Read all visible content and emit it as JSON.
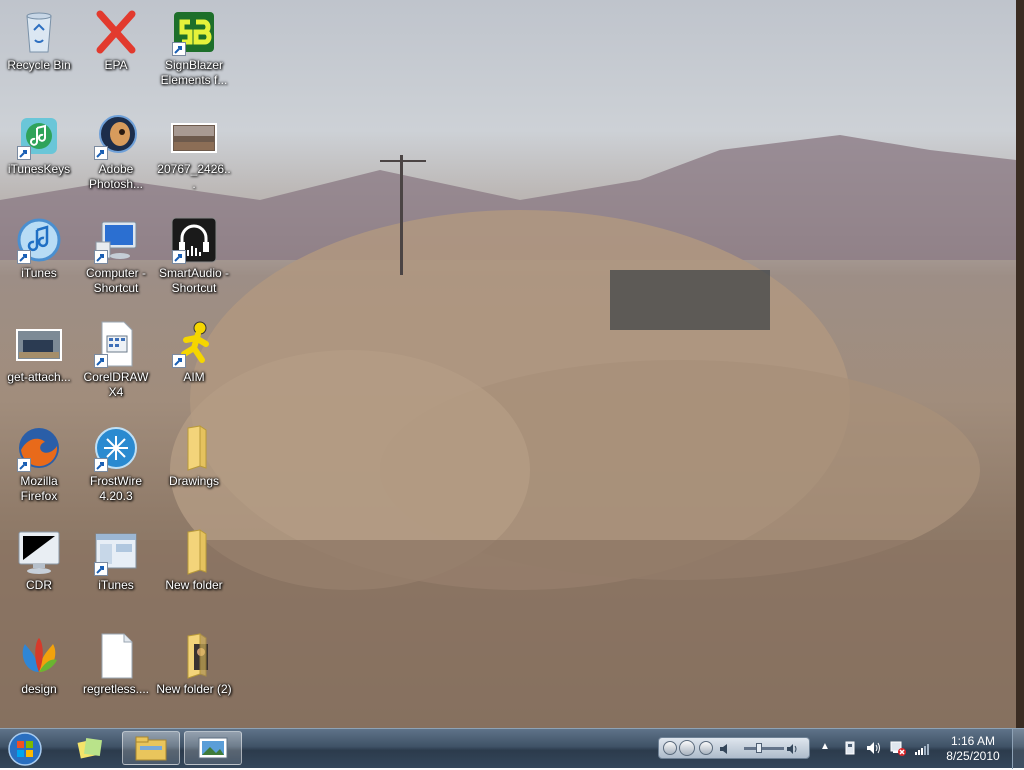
{
  "desktop": {
    "icons": [
      {
        "label": "Recycle Bin",
        "icon": "recycle-bin-icon"
      },
      {
        "label": "EPA",
        "icon": "red-x-icon"
      },
      {
        "label": "SignBlazer Elements f...",
        "icon": "signblazer-icon"
      },
      {
        "label": "iTunesKeys",
        "icon": "itunes-keys-icon"
      },
      {
        "label": "Adobe Photosh...",
        "icon": "photoshop-icon"
      },
      {
        "label": "20767_2426...",
        "icon": "photo-thumbnail-icon"
      },
      {
        "label": "iTunes",
        "icon": "itunes-icon"
      },
      {
        "label": "Computer - Shortcut",
        "icon": "computer-icon"
      },
      {
        "label": "SmartAudio - Shortcut",
        "icon": "smartaudio-icon"
      },
      {
        "label": "get-attach...",
        "icon": "image-thumbnail-icon"
      },
      {
        "label": "CorelDRAW X4",
        "icon": "document-icon"
      },
      {
        "label": "AIM",
        "icon": "aim-icon"
      },
      {
        "label": "Mozilla Firefox",
        "icon": "firefox-icon"
      },
      {
        "label": "FrostWire 4.20.3",
        "icon": "frostwire-icon"
      },
      {
        "label": "Drawings",
        "icon": "folder-icon"
      },
      {
        "label": "CDR",
        "icon": "monitor-icon"
      },
      {
        "label": "iTunes",
        "icon": "window-shortcut-icon"
      },
      {
        "label": "New folder",
        "icon": "folder-icon"
      },
      {
        "label": "design",
        "icon": "msn-butterfly-icon"
      },
      {
        "label": "regretless....",
        "icon": "blank-file-icon"
      },
      {
        "label": "New folder (2)",
        "icon": "folder-photo-icon"
      }
    ]
  },
  "taskbar": {
    "start_icon": "windows-orb-icon",
    "pinned": [
      "sticky-notes-icon",
      "explorer-folder-icon",
      "photo-viewer-icon"
    ],
    "media_controls": [
      "previous-icon",
      "play-icon",
      "next-icon",
      "volume-icon"
    ],
    "tray_icons": [
      "show-hidden-icon",
      "device-icon",
      "speaker-icon",
      "network-error-icon",
      "signal-icon"
    ],
    "clock": {
      "time": "1:16 AM",
      "date": "8/25/2010"
    }
  },
  "colors": {
    "taskbar": "#3f5266",
    "label_text": "#ffffff"
  }
}
